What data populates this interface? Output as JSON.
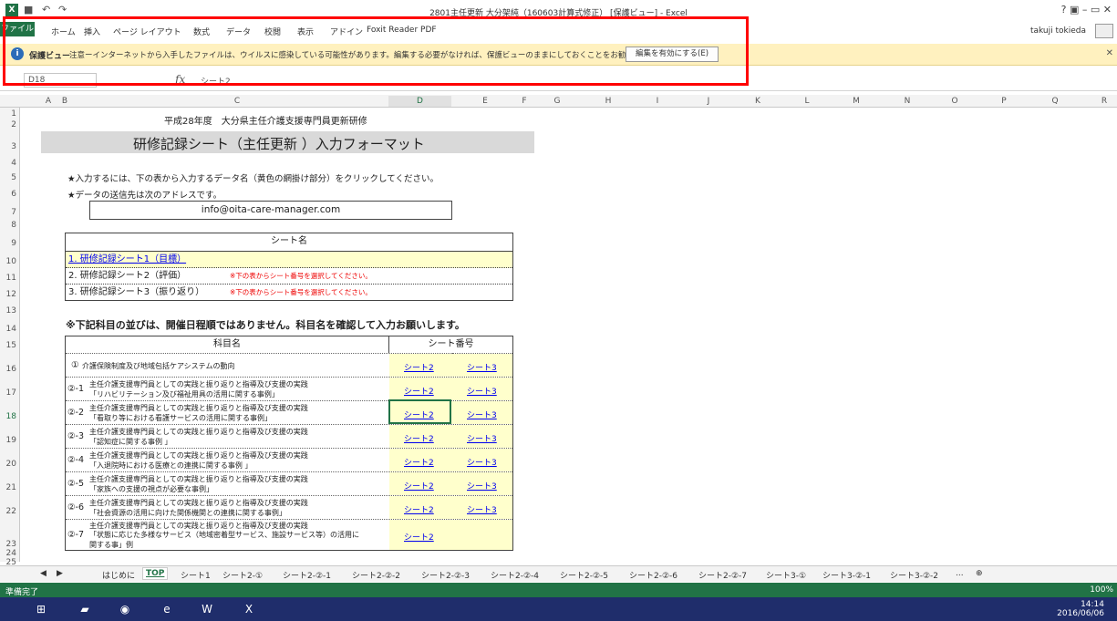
{
  "window": {
    "title": "2801主任更新 大分架純（160603計算式修正） [保護ビュー] - Excel",
    "win_controls": "?   ▣   –   ▭   ✕"
  },
  "ribbon": {
    "file": "ファイル",
    "tabs": [
      "ホーム",
      "挿入",
      "ページ レイアウト",
      "数式",
      "データ",
      "校閲",
      "表示",
      "アドイン",
      "Foxit Reader PDF"
    ],
    "user": "takuji tokieda"
  },
  "protected_view": {
    "title": "保護ビュー",
    "message": "注意ーインターネットから入手したファイルは、ウイルスに感染している可能性があります。編集する必要がなければ、保護ビューのままにしておくことをお勧めします。",
    "button": "編集を有効にする(E)"
  },
  "formula_bar": {
    "name_box": "D18",
    "fx": "fx",
    "content": "シート2"
  },
  "columns": [
    "A",
    "B",
    "C",
    "D",
    "E",
    "F",
    "G",
    "H",
    "I",
    "J",
    "K",
    "L",
    "M",
    "N",
    "O",
    "P",
    "Q",
    "R"
  ],
  "rows": [
    "1",
    "2",
    "3",
    "4",
    "5",
    "6",
    "7",
    "8",
    "9",
    "10",
    "11",
    "12",
    "13",
    "14",
    "15",
    "16",
    "17",
    "18",
    "19",
    "20",
    "21",
    "22",
    "23",
    "24",
    "25"
  ],
  "content": {
    "subtitle": "平成28年度　大分県主任介護支援専門員更新研修",
    "main_title": "研修記録シート（主任更新 ）入力フォーマット",
    "instruction1": "★入力するには、下の表から入力するデータ名（黄色の網掛け部分）をクリックしてください。",
    "instruction2": "★データの送信先は次のアドレスです。",
    "email": "info@oita-care-manager.com",
    "sheet_header": "シート名",
    "sheet_rows": [
      {
        "label": "1. 研修記録シート1（目標）",
        "note": ""
      },
      {
        "label": "2. 研修記録シート2（評価）",
        "note": "※下の表からシート番号を選択してください。"
      },
      {
        "label": "3. 研修記録シート3（振り返り）",
        "note": "※下の表からシート番号を選択してください。"
      }
    ],
    "bold_note": "※下記科目の並びは、開催日程順ではありません。科目名を確認して入力お願いします。",
    "subject_header": "科目名",
    "sheet_num_header": "シート番号",
    "link2": "シート2",
    "link3": "シート3",
    "subjects": [
      {
        "num": "①",
        "line1": "介護保険制度及び地域包括ケアシステムの動向",
        "line2": ""
      },
      {
        "num": "②-1",
        "line1": "主任介護支援専門員としての実践と振り返りと指導及び支援の実践",
        "line2": "「リハビリテーション及び福祉用具の活用に関する事例」"
      },
      {
        "num": "②-2",
        "line1": "主任介護支援専門員としての実践と振り返りと指導及び支援の実践",
        "line2": "「看取り等における看護サービスの活用に関する事例」"
      },
      {
        "num": "②-3",
        "line1": "主任介護支援専門員としての実践と振り返りと指導及び支援の実践",
        "line2": "「認知症に関する事例 」"
      },
      {
        "num": "②-4",
        "line1": "主任介護支援専門員としての実践と振り返りと指導及び支援の実践",
        "line2": "「入退院時における医療との連携に関する事例 」"
      },
      {
        "num": "②-5",
        "line1": "主任介護支援専門員としての実践と振り返りと指導及び支援の実践",
        "line2": "「家族への支援の視点が必要な事例」"
      },
      {
        "num": "②-6",
        "line1": "主任介護支援専門員としての実践と振り返りと指導及び支援の実践",
        "line2": "「社会資源の活用に向けた関係機関との連携に関する事例」"
      },
      {
        "num": "②-7",
        "line1": "主任介護支援専門員としての実践と振り返りと指導及び支援の実践",
        "line2": "「状態に応じた多様なサービス（地域密着型サービス、施設サービス等）の活用に",
        "line3": "関する事」例"
      }
    ]
  },
  "sheet_tabs": [
    "はじめに",
    "TOP",
    "シート1",
    "シート2-①",
    "シート2-②-1",
    "シート2-②-2",
    "シート2-②-3",
    "シート2-②-4",
    "シート2-②-5",
    "シート2-②-6",
    "シート2-②-7",
    "シート3-①",
    "シート3-②-1",
    "シート3-②-2",
    "..."
  ],
  "status": {
    "ready": "準備完了",
    "zoom": "100%"
  },
  "taskbar": {
    "time": "14:14",
    "date": "2016/06/06"
  },
  "colors": {
    "accent": "#217346",
    "highlight": "#ff0000",
    "link": "#0000ee",
    "yellow": "#ffffcc"
  }
}
